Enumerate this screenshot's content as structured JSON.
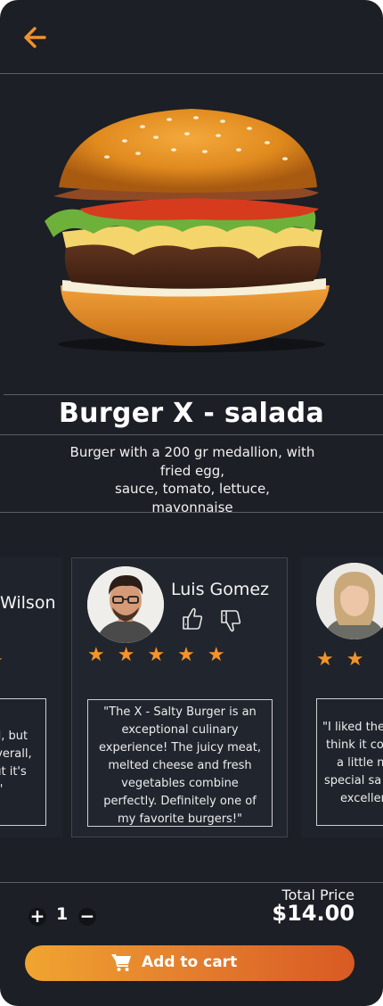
{
  "product": {
    "title": "Burger X - salada",
    "description_lines": [
      "Burger with a 200 gr medallion, with",
      "fried egg,",
      "sauce, tomato, lettuce,",
      "mayonnaise"
    ]
  },
  "reviews": [
    {
      "name": "Wilson",
      "stars": 1,
      "quote_lines": [
        "ed, but",
        "Overall,",
        "but it's",
        "d.\""
      ]
    },
    {
      "name": "Luis Gomez",
      "stars": 5,
      "quote": "\"The X - Salty Burger is an exceptional culinary experience! The juicy meat, melted cheese and fresh vegetables combine perfectly. Definitely one of my favorite burgers!\""
    },
    {
      "name": "",
      "stars": 2,
      "quote_lines": [
        "\"I liked the b",
        "think it cou",
        "a little mo",
        "special sa",
        "excellen"
      ]
    }
  ],
  "cart": {
    "quantity": "1",
    "plus": "+",
    "minus": "−",
    "total_label": "Total Price",
    "total_value": "$14.00",
    "button_label": "Add to cart"
  },
  "colors": {
    "background": "#1c1f25",
    "accent": "#f0922b",
    "star": "#f4932a"
  }
}
